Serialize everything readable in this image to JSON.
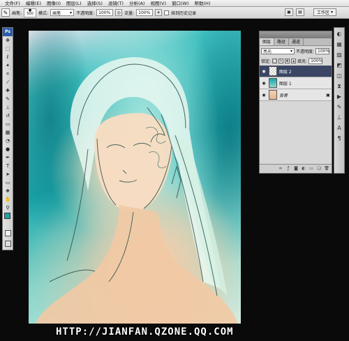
{
  "menu": {
    "items": [
      "文件(F)",
      "编辑(E)",
      "图像(I)",
      "图层(L)",
      "选择(S)",
      "滤镜(T)",
      "分析(A)",
      "视图(V)",
      "窗口(W)",
      "帮助(H)"
    ]
  },
  "options": {
    "tool_label": "画笔:",
    "brush_size": "500",
    "mode_label": "模式:",
    "mode_value": "画笔",
    "opacity_label": "不透明度:",
    "opacity_value": "100%",
    "flow_label": "流量:",
    "flow_value": "100%",
    "history_label": "抹到历史记录",
    "workspace_label": "工作区"
  },
  "toolbox": {
    "logo": "Ps",
    "foreground_color": "#1fa4a1",
    "background_color": "#ffffff"
  },
  "layers_panel": {
    "tabs": [
      "图层",
      "路径",
      "通道"
    ],
    "blend_mode": "亮光",
    "opacity_label": "不透明度:",
    "opacity_value": "100%",
    "lock_label": "锁定:",
    "fill_label": "填充:",
    "fill_value": "100%",
    "layers": [
      {
        "name": "图层 2",
        "visible": true,
        "active": true
      },
      {
        "name": "图层 1",
        "visible": true,
        "active": false
      },
      {
        "name": "背景",
        "visible": true,
        "active": false,
        "locked": true
      }
    ]
  },
  "watermark": "HTTP://JIANFAN.QZONE.QQ.COM",
  "colors": {
    "accent": "#1fa4a1",
    "active_layer": "#3a4664"
  }
}
